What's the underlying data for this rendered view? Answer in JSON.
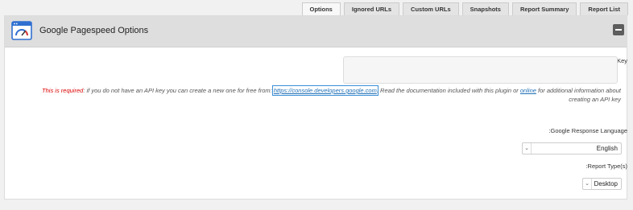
{
  "tabs": [
    {
      "label": "Options"
    },
    {
      "label": "Ignored URLs"
    },
    {
      "label": "Custom URLs"
    },
    {
      "label": "Snapshots"
    },
    {
      "label": "Report Summary"
    },
    {
      "label": "Report List"
    }
  ],
  "panel": {
    "title": "Google Pagespeed Options",
    "icon": "speedometer-browser-icon"
  },
  "fields": {
    "api_key": {
      "label": ":Google API Key",
      "value": "",
      "placeholder": ""
    },
    "notice": {
      "required": "This is required",
      "text1": ": if you do not have an API key you can create a new one for free from: ",
      "link1": "https://console.developers.google.com",
      "text2": ". Read the documentation included with this plugin or ",
      "link2": "online",
      "text3": " for additional information about creating an API key"
    },
    "language": {
      "label": ":Google Response Language",
      "value": "English"
    },
    "report_type": {
      "label": ":Report Type(s)",
      "value": "Desktop"
    }
  },
  "colors": {
    "required": "#dd0000",
    "link": "#1f6fb5",
    "header_bg": "#dedede"
  }
}
